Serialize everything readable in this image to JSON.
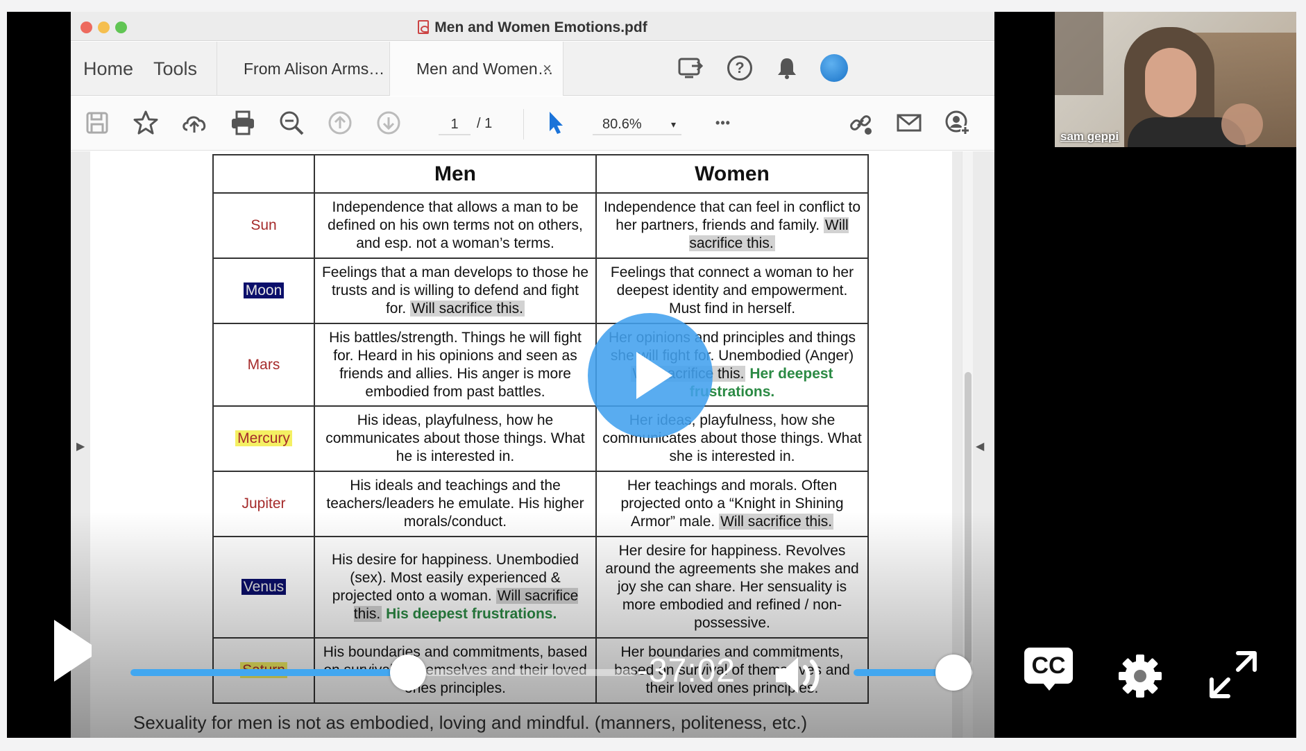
{
  "window": {
    "title": "Men and Women Emotions.pdf"
  },
  "nav": {
    "home": "Home",
    "tools": "Tools"
  },
  "tabs": [
    {
      "label": "From Alison Arms…"
    },
    {
      "label": "Men and Women…",
      "close": "×"
    }
  ],
  "toolbar": {
    "page_current": "1",
    "page_total": "/ 1",
    "zoom": "80.6%",
    "zoom_caret": "▾",
    "more": "•••"
  },
  "table": {
    "headers": [
      "",
      "Men",
      "Women"
    ],
    "rows": [
      {
        "planet": "Sun",
        "men": "Independence that allows a man to be defined on his own terms not on others, and esp. not a woman’s terms.",
        "women_1": "Independence that can feel in conflict to her partners, friends and family.",
        "women_hl": "Will sacrifice this."
      },
      {
        "planet": "Moon",
        "men_1": "Feelings that a man develops to those he trusts and is willing to defend and fight for.",
        "men_hl": "Will sacrifice this.",
        "women": "Feelings that connect a woman to her deepest identity and empowerment. Must find in herself."
      },
      {
        "planet": "Mars",
        "men": "His battles/strength. Things he will fight for. Heard in his opinions and seen as friends and allies. His anger is more embodied from past battles.",
        "women_1": "Her opinions and principles and things she will fight for. Unembodied (Anger)",
        "women_hl": "Will sacrifice this.",
        "women_green": "Her deepest frustrations."
      },
      {
        "planet": "Mercury",
        "men": "His ideas, playfulness, how he communicates about those things. What he is interested in.",
        "women": "Her ideas, playfulness, how she communicates about those things. What she is interested in."
      },
      {
        "planet": "Jupiter",
        "men": "His ideals and teachings and the teachers/leaders he emulate. His higher morals/conduct.",
        "women_1": "Her teachings and morals. Often projected onto a “Knight in Shining Armor” male.",
        "women_hl": "Will sacrifice this."
      },
      {
        "planet": "Venus",
        "men_1": "His desire for happiness. Unembodied (sex). Most easily experienced & projected onto a woman.",
        "men_hl": "Will sacrifice this.",
        "men_green": "His deepest frustrations.",
        "women": "Her desire for happiness. Revolves around the agreements she makes and joy she can share. Her sensuality is more embodied and refined / non-possessive."
      },
      {
        "planet": "Saturn",
        "men": "His boundaries and commitments, based on survival of themselves and their loved ones principles.",
        "women": "Her boundaries and commitments, based on survival of themselves and their loved ones principles."
      }
    ],
    "footnote": "Sexuality for men is not as embodied, loving and mindful. (manners, politeness, etc.)"
  },
  "player": {
    "time_remaining": "-37:02",
    "progress_fraction": 0.55,
    "volume_fraction": 0.84,
    "cc_label": "CC",
    "accent_color": "#42a7f0"
  },
  "webcam": {
    "name": "sam geppi"
  }
}
